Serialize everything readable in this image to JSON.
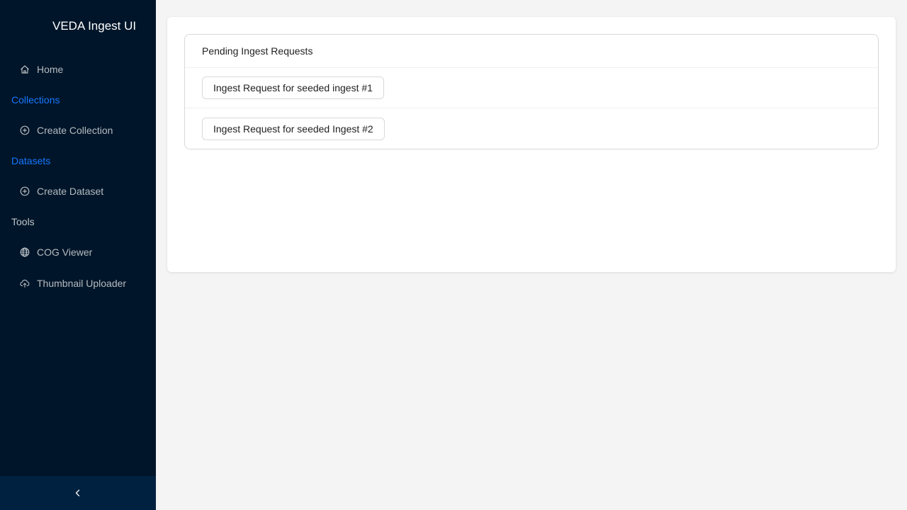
{
  "app": {
    "title": "VEDA Ingest UI"
  },
  "colors": {
    "sidebar_bg": "#001529",
    "sidebar_footer_bg": "#002140",
    "group_active": "#1677ff",
    "page_bg": "#f4f4f4"
  },
  "sidebar": {
    "home": {
      "label": "Home",
      "icon": "home-icon"
    },
    "collections": {
      "label": "Collections",
      "create": {
        "label": "Create Collection",
        "icon": "plus-circle-icon"
      }
    },
    "datasets": {
      "label": "Datasets",
      "create": {
        "label": "Create Dataset",
        "icon": "plus-circle-icon"
      }
    },
    "tools": {
      "label": "Tools",
      "cog_viewer": {
        "label": "COG Viewer",
        "icon": "globe-icon"
      },
      "thumbnail_uploader": {
        "label": "Thumbnail Uploader",
        "icon": "cloud-upload-icon"
      }
    },
    "collapse_icon": "chevron-left-icon"
  },
  "main": {
    "list_header": "Pending Ingest Requests",
    "requests": [
      "Ingest Request for seeded ingest #1",
      "Ingest Request for seeded Ingest #2"
    ]
  }
}
